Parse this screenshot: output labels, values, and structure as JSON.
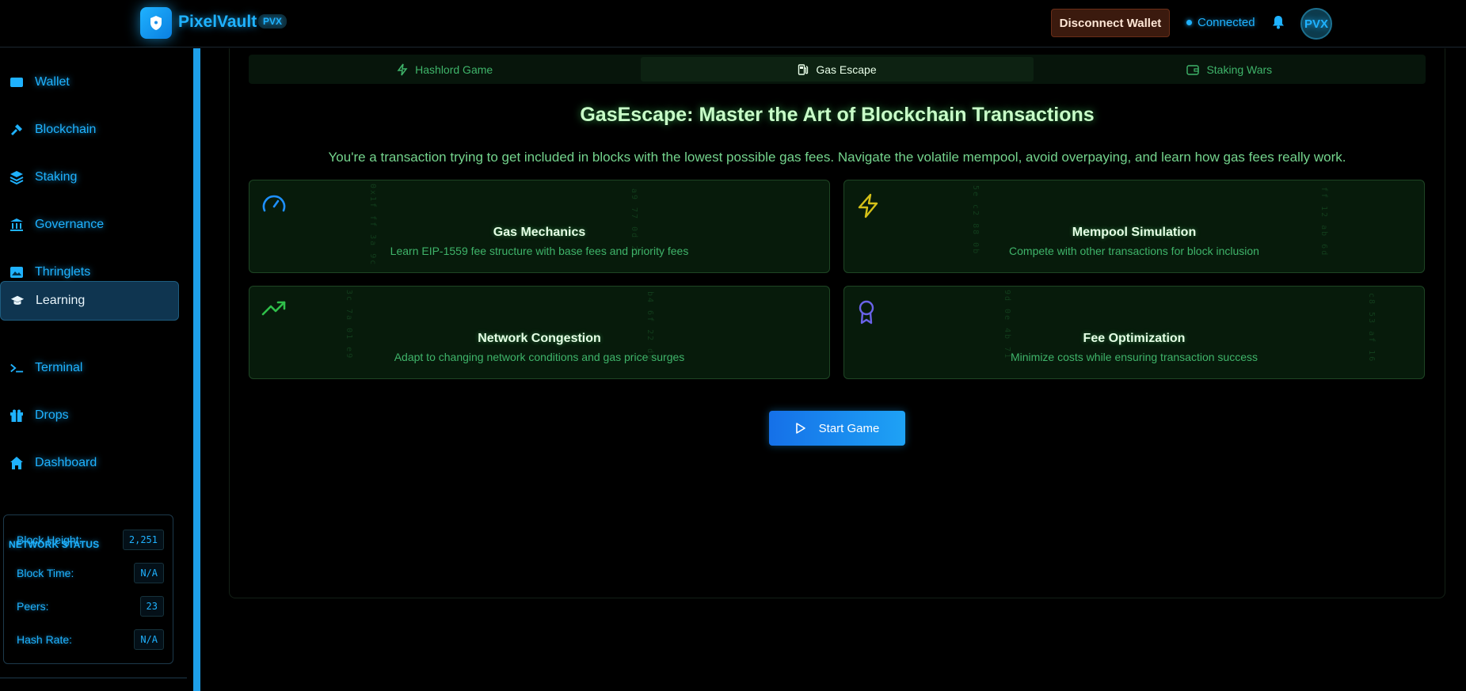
{
  "header": {
    "logo_text": "PixelVault",
    "badge": "PVX",
    "disconnect_label": "Disconnect  Wallet",
    "status": "Connected",
    "avatar_text": "PVX"
  },
  "sidebar": {
    "items": [
      {
        "label": "Wallet",
        "icon": "wallet-icon"
      },
      {
        "label": "Blockchain",
        "icon": "hammer-icon"
      },
      {
        "label": "Staking",
        "icon": "layers-icon"
      },
      {
        "label": "Governance",
        "icon": "bank-icon"
      },
      {
        "label": "Thringlets",
        "icon": "image-icon"
      },
      {
        "label": "Learning",
        "icon": "graduation-cap-icon",
        "active": true
      },
      {
        "label": "Terminal",
        "icon": "terminal-icon"
      },
      {
        "label": "Drops",
        "icon": "gift-icon"
      },
      {
        "label": "Dashboard",
        "icon": "home-icon"
      }
    ],
    "network_status": {
      "title": "NETWORK STATUS",
      "rows": [
        {
          "label": "Block Height:",
          "value": "2,251"
        },
        {
          "label": "Block Time:",
          "value": "N/A"
        },
        {
          "label": "Peers:",
          "value": "23"
        },
        {
          "label": "Hash Rate:",
          "value": "N/A"
        }
      ]
    }
  },
  "tabs": [
    {
      "label": "Hashlord Game",
      "icon": "lightning-icon"
    },
    {
      "label": "Gas Escape",
      "icon": "fuel-icon",
      "active": true
    },
    {
      "label": "Staking Wars",
      "icon": "wallet-icon"
    }
  ],
  "main": {
    "title": "GasEscape: Master the Art of Blockchain Transactions",
    "subtitle": "You're a transaction trying to get included in blocks with the lowest possible gas fees. Navigate the volatile mempool, avoid overpaying, and learn how gas fees really work.",
    "features": [
      {
        "name": "Gas Mechanics",
        "desc": "Learn EIP-1559 fee structure with base fees and priority fees",
        "icon": "gauge-icon",
        "color": "#1e90ff"
      },
      {
        "name": "Mempool Simulation",
        "desc": "Compete with other transactions for block inclusion",
        "icon": "lightning-icon",
        "color": "#d4c018"
      },
      {
        "name": "Network Congestion",
        "desc": "Adapt to changing network conditions and gas price surges",
        "icon": "trending-up-icon",
        "color": "#2fbf4a"
      },
      {
        "name": "Fee Optimization",
        "desc": "Minimize costs while ensuring transaction success",
        "icon": "award-icon",
        "color": "#6a63e8"
      }
    ],
    "start_label": "Start Game"
  }
}
